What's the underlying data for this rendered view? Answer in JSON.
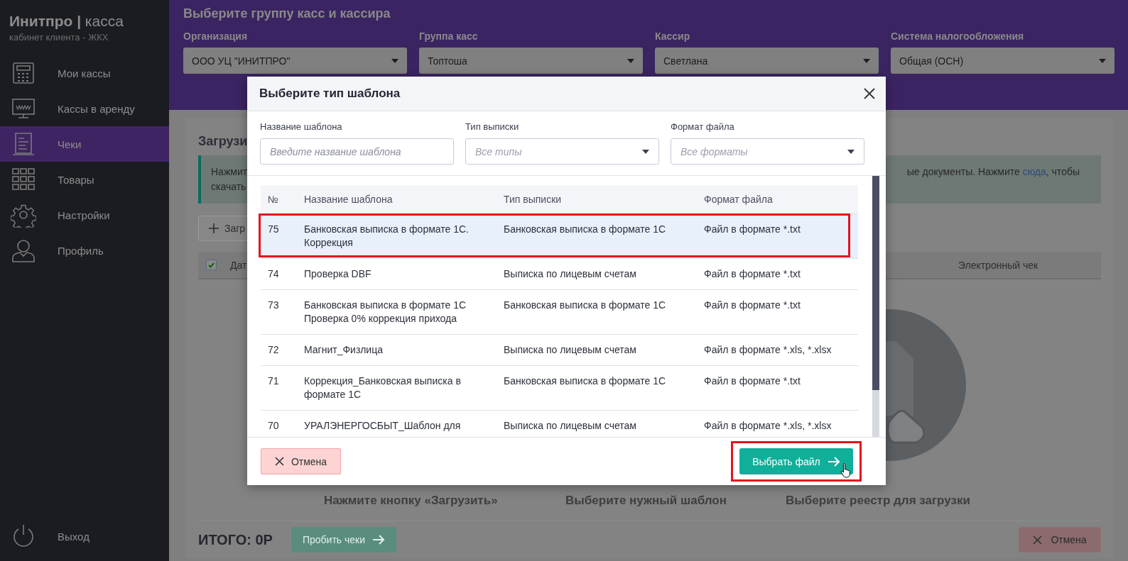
{
  "sidebar": {
    "brand": "**Инитпро |** касса",
    "subtitle": "кабинет клиента - ЖКХ",
    "items": [
      {
        "label": "Мои кассы",
        "selected": false
      },
      {
        "label": "Кассы в аренду",
        "selected": false
      },
      {
        "label": "Чеки",
        "selected": true
      },
      {
        "label": "Товары",
        "selected": false
      },
      {
        "label": "Настройки",
        "selected": false
      },
      {
        "label": "Профиль",
        "selected": false
      }
    ],
    "logout": "Выход"
  },
  "header": {
    "title": "Выберите группу касс и кассира",
    "filters": [
      {
        "label": "Организация",
        "value": "ООО УЦ \"ИНИТПРО\""
      },
      {
        "label": "Группа касс",
        "value": "Топтоша"
      },
      {
        "label": "Кассир",
        "value": "Светлана"
      },
      {
        "label": "Система налогообложения",
        "value": "Общая (ОСН)"
      }
    ]
  },
  "page": {
    "title": "Загрузи",
    "info_left": [
      "Нажмит",
      "скачать"
    ],
    "info_before": "ые документы. Нажмите ",
    "info_link": "сюда",
    "info_after": ", чтобы",
    "upload_button": "Загр",
    "table": {
      "checked": true,
      "column_1": "Дат",
      "column_2": "Электронный чек"
    },
    "steps": [
      "Нажмите кнопку «Загрузить»",
      "Выберите нужный шаблон",
      "Выберите реестр для загрузки"
    ],
    "total": "ИТОГО: 0Р",
    "submit_button": "Пробить чеки",
    "cancel_button": "Отмена"
  },
  "dialog": {
    "title": "Выберите тип шаблона",
    "filters": [
      {
        "kind": "text",
        "label": "Название шаблона",
        "placeholder": "Введите название шаблона"
      },
      {
        "kind": "select",
        "label": "Тип выписки",
        "placeholder": "Все типы"
      },
      {
        "kind": "select",
        "label": "Формат файла",
        "placeholder": "Все форматы"
      }
    ],
    "columns": [
      "№",
      "Название шаблона",
      "Тип выписки",
      "Формат файла"
    ],
    "rows": [
      {
        "number": "75",
        "name": "Банковская выписка в формате 1С. Коррекция",
        "type": "Банковская выписка в формате 1С",
        "format": "Файл в формате *.txt",
        "selected": true,
        "marked": true
      },
      {
        "number": "74",
        "name": "Проверка DBF",
        "type": "Выписка по лицевым счетам",
        "format": "Файл в формате *.txt",
        "selected": false,
        "marked": false
      },
      {
        "number": "73",
        "name": "Банковская выписка в формате 1С Проверка 0% коррекция прихода",
        "type": "Банковская выписка в формате 1С",
        "format": "Файл в формате *.txt",
        "selected": false,
        "marked": false
      },
      {
        "number": "72",
        "name": "Магнит_Физлица",
        "type": "Выписка по лицевым счетам",
        "format": "Файл в формате *.xls, *.xlsx",
        "selected": false,
        "marked": false
      },
      {
        "number": "71",
        "name": "Коррекция_Банковская выписка в формате 1С",
        "type": "Банковская выписка в формате 1С",
        "format": "Файл в формате *.txt",
        "selected": false,
        "marked": false
      },
      {
        "number": "70",
        "name": "УРАЛЭНЕРГОСБЫТ_Шаблон для",
        "type": "Выписка по лицевым счетам",
        "format": "Файл в формате *.xls, *.xlsx",
        "selected": false,
        "marked": false
      }
    ],
    "cancel_button": "Отмена",
    "choose_button": "Выбрать файл",
    "choose_marked": true
  }
}
